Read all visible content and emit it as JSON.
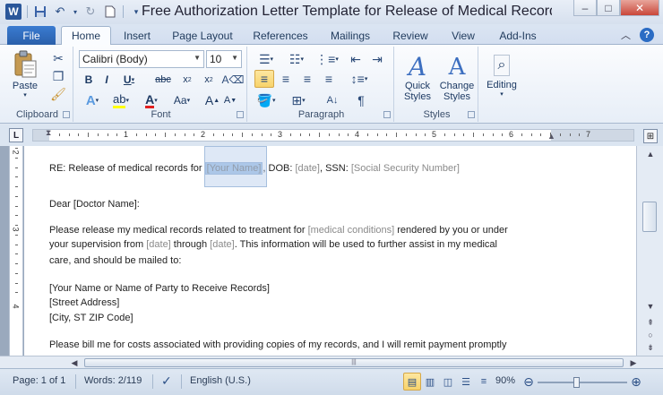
{
  "titlebar": {
    "title": "Free Authorization Letter Template for Release of Medical Records M",
    "app_icon": "W"
  },
  "tabs": [
    "File",
    "Home",
    "Insert",
    "Page Layout",
    "References",
    "Mailings",
    "Review",
    "View",
    "Add-Ins"
  ],
  "ribbon": {
    "clipboard": {
      "paste": "Paste",
      "label": "Clipboard"
    },
    "font": {
      "name": "Calibri (Body)",
      "size": "10",
      "label": "Font"
    },
    "paragraph": {
      "label": "Paragraph"
    },
    "styles": {
      "quick": "Quick\nStyles",
      "quick_l1": "Quick",
      "quick_l2": "Styles",
      "change_l1": "Change",
      "change_l2": "Styles",
      "label": "Styles"
    },
    "editing": {
      "label": "Editing"
    }
  },
  "ruler": {
    "numbers": [
      "1",
      "2",
      "3",
      "4",
      "5",
      "6",
      "7"
    ],
    "vnumbers": [
      "2",
      "3",
      "4"
    ]
  },
  "document": {
    "re_prefix": "RE: Release of medical records for ",
    "re_name": "[Your Name]",
    "re_dob": ", DOB: ",
    "re_date": "[date]",
    "re_ssn": ", SSN: ",
    "re_ssn_ph": "[Social Security Number]",
    "dear": "Dear [Doctor Name]:",
    "p1_a": "Please release my medical records related to treatment for ",
    "p1_cond": "[medical conditions]",
    "p1_b": " rendered by you or under",
    "p2_a": "your supervision from ",
    "p2_d1": "[date]",
    "p2_b": " through ",
    "p2_d2": "[date]",
    "p2_c": ". This information will be used to further assist in my medical",
    "p3": "care, and should be mailed to:",
    "addr1": "[Your Name or Name of Party to Receive Records]",
    "addr2": "[Street Address]",
    "addr3": "[City, ST  ZIP Code]",
    "bill": "Please bill me for costs associated with providing  copies  of my records,  and I will remit payment  promptly"
  },
  "status": {
    "page": "Page: 1 of 1",
    "words": "Words: 2/119",
    "language": "English (U.S.)",
    "zoom": "90%",
    "zoom_percent": 90
  }
}
